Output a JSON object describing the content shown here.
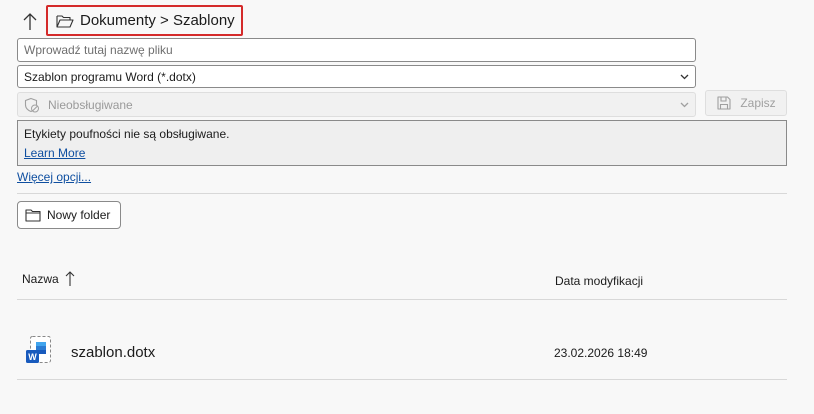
{
  "breadcrumb": {
    "path": "Dokumenty > Szablony"
  },
  "filename": {
    "placeholder": "Wprowadź tutaj nazwę pliku",
    "value": ""
  },
  "filetype": {
    "selected": "Szablon programu Word (*.dotx)"
  },
  "sensitivity": {
    "selected": "Nieobsługiwane"
  },
  "save": {
    "label": "Zapisz"
  },
  "info": {
    "text": "Etykiety poufności nie są obsługiwane.",
    "link": "Learn More"
  },
  "more_options": "Więcej opcji...",
  "new_folder": {
    "label": "Nowy folder"
  },
  "columns": {
    "name": "Nazwa",
    "date": "Data modyfikacji"
  },
  "files": [
    {
      "name": "szablon.dotx",
      "modified": "23.02.2026 18:49",
      "icon": "word-template-icon"
    }
  ],
  "colors": {
    "accent_link": "#0f4fa0",
    "highlight_border": "#d42a2a",
    "word_blue": "#185abd"
  }
}
